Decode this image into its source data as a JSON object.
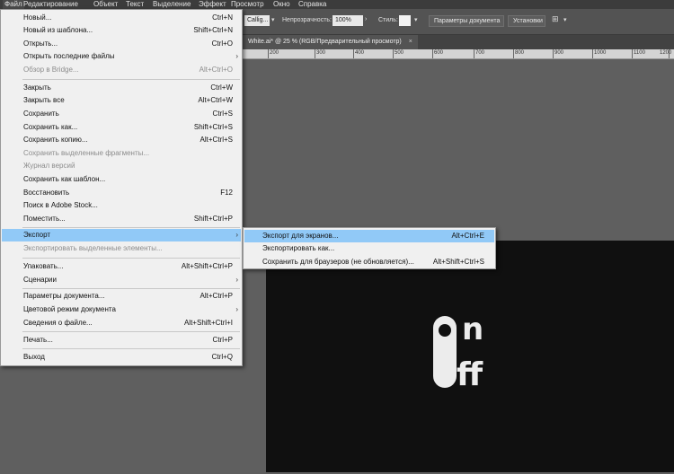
{
  "menubar": [
    "Файл",
    "Редактирование",
    "Объект",
    "Текст",
    "Выделение",
    "Эффект",
    "Просмотр",
    "Окно",
    "Справка"
  ],
  "controlbar": {
    "font_value": "Callig...",
    "opacity_label": "Непрозрачность:",
    "opacity_value": "100%",
    "style_label": "Стиль:",
    "doc_settings": "Параметры документа",
    "prefs": "Установки"
  },
  "document_tab": {
    "title": "White.ai* @ 25 % (RGB/Предварительный просмотр)",
    "close": "×"
  },
  "ruler_ticks": [
    "200",
    "300",
    "400",
    "500",
    "600",
    "700",
    "800",
    "900",
    "1000",
    "1100",
    "1200"
  ],
  "file_menu": {
    "items": [
      {
        "label": "Новый...",
        "shortcut": "Ctrl+N"
      },
      {
        "label": "Новый из шаблона...",
        "shortcut": "Shift+Ctrl+N"
      },
      {
        "label": "Открыть...",
        "shortcut": "Ctrl+O"
      },
      {
        "label": "Открыть последние файлы",
        "shortcut": ""
      },
      {
        "label": "Обзор в Bridge...",
        "shortcut": "Alt+Ctrl+O"
      },
      {
        "label": "Закрыть",
        "shortcut": "Ctrl+W"
      },
      {
        "label": "Закрыть все",
        "shortcut": "Alt+Ctrl+W"
      },
      {
        "label": "Сохранить",
        "shortcut": "Ctrl+S"
      },
      {
        "label": "Сохранить как...",
        "shortcut": "Shift+Ctrl+S"
      },
      {
        "label": "Сохранить копию...",
        "shortcut": "Alt+Ctrl+S"
      },
      {
        "label": "Сохранить выделенные фрагменты...",
        "shortcut": ""
      },
      {
        "label": "Журнал версий",
        "shortcut": ""
      },
      {
        "label": "Сохранить как шаблон...",
        "shortcut": ""
      },
      {
        "label": "Восстановить",
        "shortcut": "F12"
      },
      {
        "label": "Поиск в Adobe Stock...",
        "shortcut": ""
      },
      {
        "label": "Поместить...",
        "shortcut": "Shift+Ctrl+P"
      },
      {
        "label": "Экспорт",
        "shortcut": ""
      },
      {
        "label": "Экспортировать выделенные элементы...",
        "shortcut": ""
      },
      {
        "label": "Упаковать...",
        "shortcut": "Alt+Shift+Ctrl+P"
      },
      {
        "label": "Сценарии",
        "shortcut": ""
      },
      {
        "label": "Параметры документа...",
        "shortcut": "Alt+Ctrl+P"
      },
      {
        "label": "Цветовой режим документа",
        "shortcut": ""
      },
      {
        "label": "Сведения о файле...",
        "shortcut": "Alt+Shift+Ctrl+I"
      },
      {
        "label": "Печать...",
        "shortcut": "Ctrl+P"
      },
      {
        "label": "Выход",
        "shortcut": "Ctrl+Q"
      }
    ]
  },
  "export_submenu": {
    "items": [
      {
        "label": "Экспорт для экранов...",
        "shortcut": "Alt+Ctrl+E"
      },
      {
        "label": "Экспортировать как...",
        "shortcut": ""
      },
      {
        "label": "Сохранить для браузеров (не обновляется)...",
        "shortcut": "Alt+Shift+Ctrl+S"
      }
    ]
  },
  "artwork": {
    "logo_text": "On ff"
  },
  "colors": {
    "menu_bg": "#f0f0f0",
    "highlight": "#91c9f7",
    "artboard": "#101010",
    "workspace": "#5f5f5f"
  }
}
